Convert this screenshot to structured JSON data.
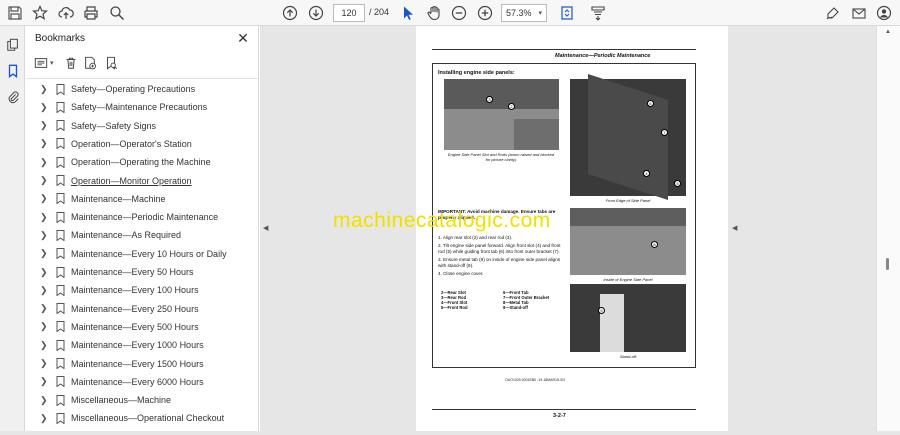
{
  "toolbar": {
    "page_current": "120",
    "page_total": "/  204",
    "zoom": "57.3%"
  },
  "bookmarks": {
    "title": "Bookmarks",
    "items": [
      {
        "label": "Safety—Operating Precautions",
        "underline": false
      },
      {
        "label": "Safety—Maintenance Precautions",
        "underline": false
      },
      {
        "label": "Safety—Safety Signs",
        "underline": false
      },
      {
        "label": "Operation—Operator's Station",
        "underline": false
      },
      {
        "label": "Operation—Operating the Machine",
        "underline": false
      },
      {
        "label": "Operation—Monitor Operation",
        "underline": true
      },
      {
        "label": "Maintenance—Machine",
        "underline": false
      },
      {
        "label": "Maintenance—Periodic Maintenance",
        "underline": false
      },
      {
        "label": "Maintenance—As Required",
        "underline": false
      },
      {
        "label": "Maintenance—Every 10 Hours or Daily",
        "underline": false
      },
      {
        "label": "Maintenance—Every 50 Hours",
        "underline": false
      },
      {
        "label": "Maintenance—Every 100 Hours",
        "underline": false
      },
      {
        "label": "Maintenance—Every 250 Hours",
        "underline": false
      },
      {
        "label": "Maintenance—Every 500 Hours",
        "underline": false
      },
      {
        "label": "Maintenance—Every 1000 Hours",
        "underline": false
      },
      {
        "label": "Maintenance—Every 1500 Hours",
        "underline": false
      },
      {
        "label": "Maintenance—Every 6000 Hours",
        "underline": false
      },
      {
        "label": "Miscellaneous—Machine",
        "underline": false
      },
      {
        "label": "Miscellaneous—Operational Checkout",
        "underline": false
      }
    ]
  },
  "document": {
    "header": "Maintenance—Periodic Maintenance",
    "section": "Installing engine side panels:",
    "caption1": "Engine Side Panel Slot and Rods (boom raised and blocked for picture clarity)",
    "caption2": "Front Edge of Side Panel",
    "caption3": "Inside of Engine Side Panel",
    "caption4": "Stand-off",
    "important": "IMPORTANT: Avoid machine damage. Ensure tabs are properly aligned.",
    "steps": [
      "1.  Align rear slot (2) and rear rod (3).",
      "2.  Tilt engine side panel forward. Align front slot (4) and front rod (5) while guiding front tab (6) into front outer bracket (7).",
      "3.  Ensure metal tab (8) on inside of engine side panel aligns with stand-off (9).",
      "4.  Close engine cover."
    ],
    "legend_left": [
      "2—Rear Slot",
      "3—Rear Rod",
      "4—Front Slot",
      "5—Front Rod"
    ],
    "legend_right": [
      "6—Front Tab",
      "7—Front Outer Bracket",
      "8—Metal Tab",
      "9—Stand-off"
    ],
    "page_number": "3-2-7",
    "footer_code": "OUO1029,0001EB0 -19-18MAR15-3/3",
    "watermark": "machinecatalogic.com"
  },
  "colors": {
    "watermark": "#f0e000",
    "toolbar_bg": "#f7f7f7",
    "viewer_bg": "#e6e6e6"
  }
}
